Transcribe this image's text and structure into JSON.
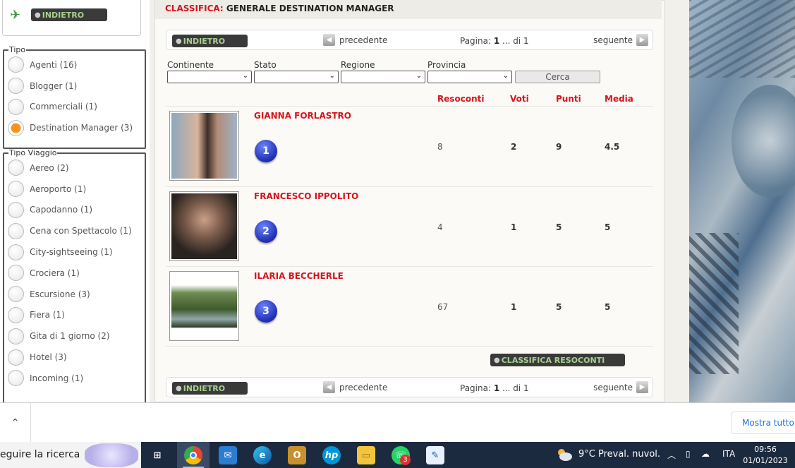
{
  "top_back_label": "INDIETRO",
  "tipo": {
    "legend": "Tipo",
    "options": [
      {
        "label": "Agenti (16)",
        "selected": false
      },
      {
        "label": "Blogger (1)",
        "selected": false
      },
      {
        "label": "Commerciali (1)",
        "selected": false
      },
      {
        "label": "Destination Manager (3)",
        "selected": true
      }
    ]
  },
  "tipo_viaggio": {
    "legend": "Tipo Viaggio",
    "options": [
      {
        "label": "Aereo (2)"
      },
      {
        "label": "Aeroporto (1)"
      },
      {
        "label": "Capodanno (1)"
      },
      {
        "label": "Cena con Spettacolo (1)"
      },
      {
        "label": "City-sightseeing (1)"
      },
      {
        "label": "Crociera (1)"
      },
      {
        "label": "Escursione (3)"
      },
      {
        "label": "Fiera (1)"
      },
      {
        "label": "Gita di 1 giorno (2)"
      },
      {
        "label": "Hotel (3)"
      },
      {
        "label": "Incoming (1)"
      }
    ]
  },
  "title": {
    "prefix": "CLASSIFICA:",
    "text": "GENERALE DESTINATION MANAGER"
  },
  "pager": {
    "back": "INDIETRO",
    "prev": "precedente",
    "next": "seguente",
    "page_label": "Pagina:",
    "page": "1",
    "of": "... di 1"
  },
  "filters": [
    {
      "label": "Continente",
      "value": ""
    },
    {
      "label": "Stato",
      "value": ""
    },
    {
      "label": "Regione",
      "value": ""
    },
    {
      "label": "Provincia",
      "value": ""
    }
  ],
  "search_button": "Cerca",
  "columns": [
    "Resoconti",
    "Voti",
    "Punti",
    "Media"
  ],
  "rows": [
    {
      "rank": "1",
      "name": "GIANNA FORLASTRO",
      "resoconti": "8",
      "voti": "2",
      "punti": "9",
      "media": "4.5"
    },
    {
      "rank": "2",
      "name": "FRANCESCO IPPOLITO",
      "resoconti": "4",
      "voti": "1",
      "punti": "5",
      "media": "5"
    },
    {
      "rank": "3",
      "name": "ILARIA BECCHERLE",
      "resoconti": "67",
      "voti": "1",
      "punti": "5",
      "media": "5"
    }
  ],
  "ranking_button": "CLASSIFICA RESOCONTI",
  "download_bar": {
    "show_all": "Mostra tutto"
  },
  "taskbar": {
    "search_text": "eguire la ricerca",
    "whatsapp_badge": "3",
    "weather": "9°C  Preval. nuvol.",
    "language": "ITA",
    "time": "09:56",
    "date": "01/01/2023"
  },
  "colors": {
    "accent_red": "#d6141d",
    "radio_selected": "#f7931e",
    "button_dark": "#3a3a3a",
    "taskbar": "#1c2a3f"
  }
}
